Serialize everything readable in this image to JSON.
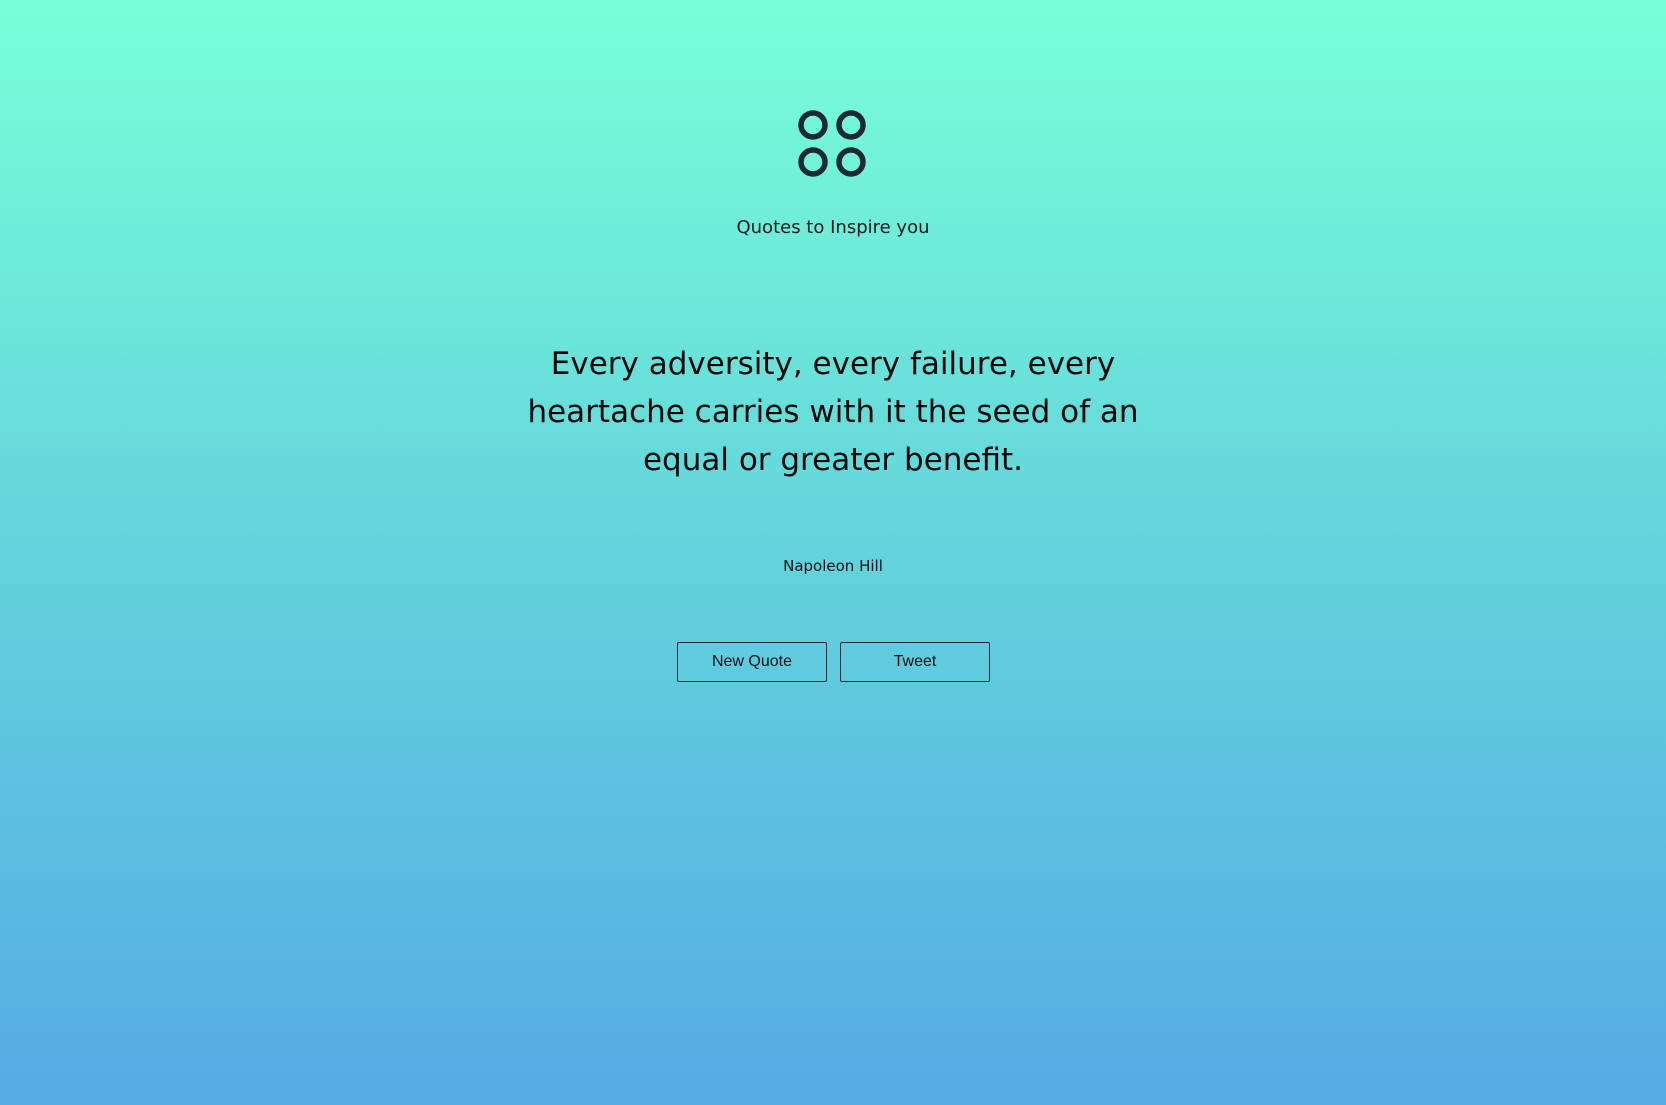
{
  "header": {
    "logo_icon": "four-circles-icon",
    "tagline": "Quotes to Inspire you"
  },
  "quote": {
    "text": "Every adversity, every failure, every heartache carries with it the seed of an equal or greater benefit.",
    "author": "Napoleon Hill"
  },
  "actions": {
    "new_quote_label": "New Quote",
    "tweet_label": "Tweet"
  },
  "colors": {
    "gradient_top": "#78ffd8",
    "gradient_bottom": "#56aae5",
    "text": "#0b1216",
    "icon": "#1f2a30"
  }
}
